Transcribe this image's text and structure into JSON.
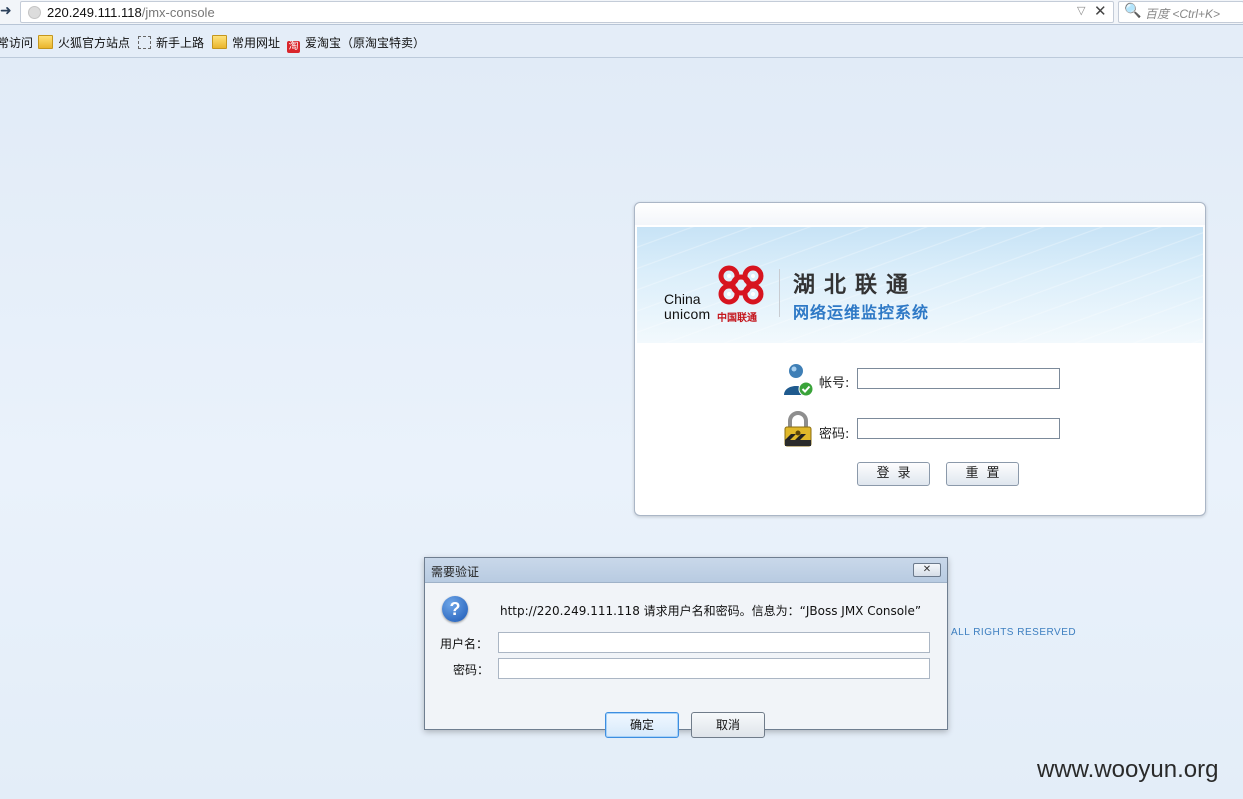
{
  "browser": {
    "url_host": "220.249.111.118",
    "url_path": "/jmx-console",
    "search_placeholder": "百度 <Ctrl+K>",
    "bookmarks": [
      {
        "label": "常访问",
        "icon": "none"
      },
      {
        "label": "火狐官方站点",
        "icon": "folder-icon"
      },
      {
        "label": "新手上路",
        "icon": "dashed-folder-icon"
      },
      {
        "label": "常用网址",
        "icon": "folder-icon"
      },
      {
        "label": "爱淘宝（原淘宝特卖）",
        "icon": "taobao-icon"
      }
    ],
    "taobao_glyph": "淘"
  },
  "login": {
    "logo_china": "China",
    "logo_unicom": "unicom",
    "logo_cn": "中国联通",
    "org_title": "湖北联通",
    "system_title": "网络运维监控系统",
    "account_label": "帐号:",
    "password_label": "密码:",
    "login_button": "登录",
    "reset_button": "重置",
    "brand_red": "#d7141f",
    "brand_blue": "#2e79c6"
  },
  "footer": {
    "rights": "ALL RIGHTS RESERVED",
    "watermark": "www.wooyun.org"
  },
  "dialog": {
    "title": "需要验证",
    "close_glyph": "✕",
    "message": "http://220.249.111.118 请求用户名和密码。信息为：“JBoss JMX Console”",
    "username_label": "用户名：",
    "password_label": "密码：",
    "ok_button": "确定",
    "cancel_button": "取消",
    "username_value": "",
    "password_value": ""
  }
}
